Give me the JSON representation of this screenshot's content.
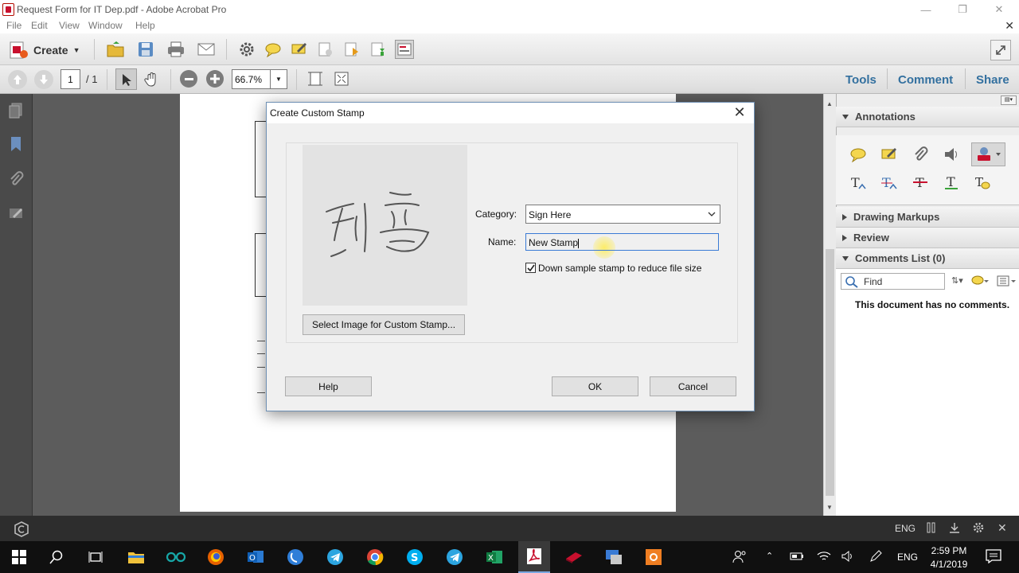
{
  "window": {
    "title": "Request Form for IT Dep.pdf - Adobe Acrobat Pro",
    "minimize": "—",
    "maximize": "❐",
    "close": "✕"
  },
  "menu": [
    "File",
    "Edit",
    "View",
    "Window",
    "Help"
  ],
  "menu_close": "✕",
  "toolbar": {
    "create_label": "Create"
  },
  "nav": {
    "page_current": "1",
    "page_total": "/ 1",
    "zoom": "66.7%"
  },
  "tabs": [
    "Tools",
    "Comment",
    "Share"
  ],
  "right_panel": {
    "annotations": "Annotations",
    "drawing_markups": "Drawing Markups",
    "review": "Review",
    "comments_list": "Comments List (0)",
    "find_placeholder": "Find",
    "no_comments": "This document has no comments."
  },
  "dialog": {
    "title": "Create Custom Stamp",
    "category_label": "Category:",
    "category_value": "Sign Here",
    "name_label": "Name:",
    "name_value": "New Stamp",
    "downsample_label": "Down sample stamp to reduce file size",
    "downsample_checked": true,
    "select_image_button": "Select Image for Custom Stamp...",
    "help_button": "Help",
    "ok_button": "OK",
    "cancel_button": "Cancel"
  },
  "statusbar": {
    "lang": "ENG"
  },
  "taskbar": {
    "lang": "ENG",
    "time": "2:59 PM",
    "date": "4/1/2019"
  },
  "colors": {
    "accent_blue": "#33709f",
    "acrobat_red": "#c8102e",
    "dialog_border": "#6d8fb3"
  }
}
